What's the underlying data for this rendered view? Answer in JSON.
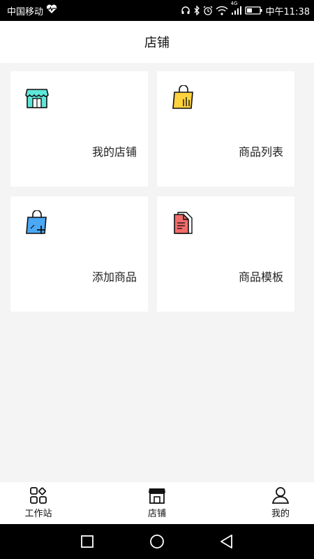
{
  "status": {
    "carrier": "中国移动",
    "time": "中午11:38",
    "network": "4G"
  },
  "header": {
    "title": "店铺"
  },
  "cards": [
    {
      "label": "我的店铺",
      "icon": "store-icon"
    },
    {
      "label": "商品列表",
      "icon": "shopping-bag-list-icon"
    },
    {
      "label": "添加商品",
      "icon": "shopping-bag-add-icon"
    },
    {
      "label": "商品模板",
      "icon": "document-template-icon"
    }
  ],
  "tabbar": {
    "items": [
      {
        "label": "工作站",
        "icon": "grid-apps-icon"
      },
      {
        "label": "店铺",
        "icon": "store-icon"
      },
      {
        "label": "我的",
        "icon": "user-icon"
      }
    ]
  },
  "colors": {
    "store_teal": "#5ee6d9",
    "bag_yellow": "#ffd23f",
    "bag_blue": "#4aa8f5",
    "doc_red": "#f36b6b"
  }
}
